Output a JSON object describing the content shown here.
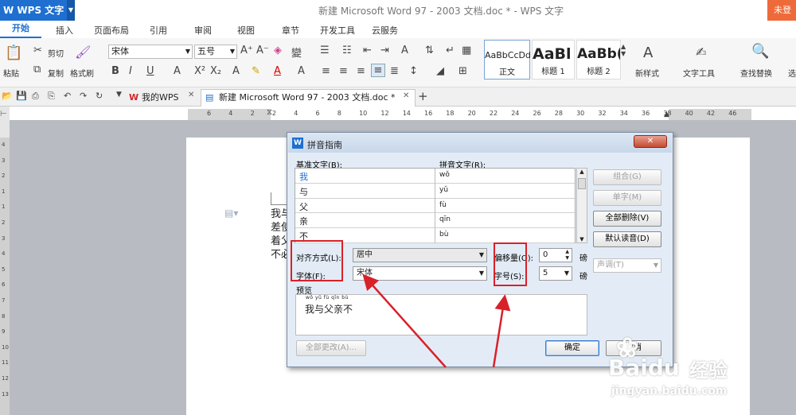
{
  "app": {
    "brand": "WPS 文字",
    "doc_title": "新建 Microsoft Word 97 - 2003 文档.doc * - WPS 文字",
    "login": "未登"
  },
  "menu": [
    "开始",
    "插入",
    "页面布局",
    "引用",
    "审阅",
    "视图",
    "章节",
    "开发工具",
    "云服务"
  ],
  "ribbon": {
    "paste": "粘贴",
    "cut": "剪切",
    "copy": "复制",
    "format_painter": "格式刷",
    "font": "宋体",
    "size": "五号",
    "styles": [
      {
        "sample": "AaBbCcDd",
        "label": "正文"
      },
      {
        "sample": "AaBl",
        "label": "标题 1"
      },
      {
        "sample": "AaBb(",
        "label": "标题 2"
      }
    ],
    "new_style": "新样式",
    "text_tools": "文字工具",
    "find_replace": "查找替换",
    "select": "选"
  },
  "tabs": {
    "my_wps": "我的WPS",
    "doc": "新建 Microsoft Word 97 - 2003 文档.doc *"
  },
  "ruler": {
    "h": [
      "6",
      "4",
      "2",
      "2",
      "4",
      "6",
      "8",
      "10",
      "12",
      "14",
      "16",
      "18",
      "20",
      "22",
      "24",
      "26",
      "28",
      "30",
      "32",
      "34",
      "36",
      "38",
      "40",
      "42",
      "46"
    ],
    "v": [
      "4",
      "3",
      "2",
      "1",
      "1",
      "2",
      "3",
      "4",
      "5",
      "6",
      "7",
      "8",
      "9",
      "10",
      "11",
      "12",
      "13"
    ]
  },
  "page_text": [
    "我与",
    "差使",
    "着父",
    "不必"
  ],
  "dialog": {
    "title": "拼音指南",
    "base_header": "基准文字(B):",
    "ruby_header": "拼音文字(R):",
    "rows": [
      {
        "base": "我",
        "ruby": "wǒ"
      },
      {
        "base": "与",
        "ruby": "yǔ"
      },
      {
        "base": "父",
        "ruby": "fù"
      },
      {
        "base": "亲",
        "ruby": "qīn"
      },
      {
        "base": "不",
        "ruby": "bù"
      }
    ],
    "btn_combine": "组合(G)",
    "btn_single": "单字(M)",
    "btn_clear": "全部删除(V)",
    "btn_default": "默认读音(D)",
    "tone": "声调(T)",
    "align_label": "对齐方式(L):",
    "align_value": "居中",
    "offset_label": "偏移量(O):",
    "offset_value": "0",
    "unit1": "磅",
    "font_label": "字体(F):",
    "font_value": "宋体",
    "size_label": "字号(S):",
    "size_value": "5",
    "unit2": "磅",
    "preview_label": "预览",
    "preview_ruby": "wǒ yǔ fù qīn bù",
    "preview_text": "我与父亲不",
    "btn_change_all": "全部更改(A)...",
    "btn_ok": "确定",
    "btn_cancel": "取消"
  },
  "watermark": {
    "brand": "Baidu",
    "cn": "经验",
    "url": "jingyan.baidu.com"
  }
}
